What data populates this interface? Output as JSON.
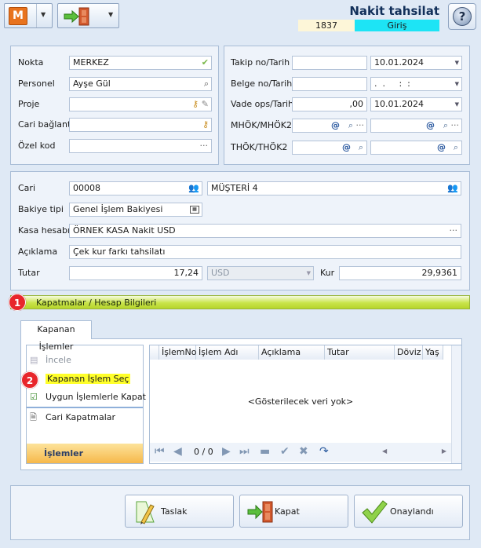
{
  "window": {
    "title": "Nakit tahsilat",
    "doc_number": "1837",
    "doc_type": "Giriş",
    "help_label": "?"
  },
  "toolbar": {
    "menu_letter": "M"
  },
  "form": {
    "nokta_label": "Nokta",
    "nokta_value": "MERKEZ",
    "personel_label": "Personel",
    "personel_value": "Ayşe Gül",
    "proje_label": "Proje",
    "proje_value": "",
    "cari_baglanti_label": "Cari bağlantı",
    "ozel_kod_label": "Özel kod",
    "takip_label": "Takip no/Tarih",
    "takip_date": "10.01.2024",
    "belge_label": "Belge no/Tarih",
    "belge_date": ".  .     :  :",
    "vade_label": "Vade ops/Tarih",
    "vade_value": ",00",
    "vade_date": "10.01.2024",
    "mhok_label": "MHÖK/MHÖK2",
    "thok_label": "THÖK/THÖK2"
  },
  "cari": {
    "cari_label": "Cari",
    "cari_code": "00008",
    "cari_name": "MÜŞTERİ 4",
    "bakiye_label": "Bakiye tipi",
    "bakiye_value": "Genel İşlem Bakiyesi",
    "kasa_label": "Kasa hesabı",
    "kasa_value": "ÖRNEK KASA Nakit USD",
    "aciklama_label": "Açıklama",
    "aciklama_value": "Çek kur farkı tahsilatı",
    "tutar_label": "Tutar",
    "tutar_value": "17,24",
    "currency": "USD",
    "kur_label": "Kur",
    "kur_value": "29,9361"
  },
  "section": {
    "header": "Kapatmalar / Hesap Bilgileri",
    "badge1": "1",
    "badge2": "2",
    "tab_label": "Kapanan İşlemler",
    "side_items": [
      "İncele",
      "Kapanan İşlem Seç",
      "Uygun İşlemlerle Kapat",
      "Cari Kapatmalar"
    ],
    "side_footer": "İşlemler",
    "columns": [
      "İşlemNo",
      "İşlem Adı",
      "Açıklama",
      "Tutar",
      "Döviz",
      "Yaş"
    ],
    "empty_text": "<Gösterilecek veri yok>",
    "pager": "0 / 0"
  },
  "buttons": {
    "draft": "Taslak",
    "close": "Kapat",
    "approved": "Onaylandı"
  }
}
